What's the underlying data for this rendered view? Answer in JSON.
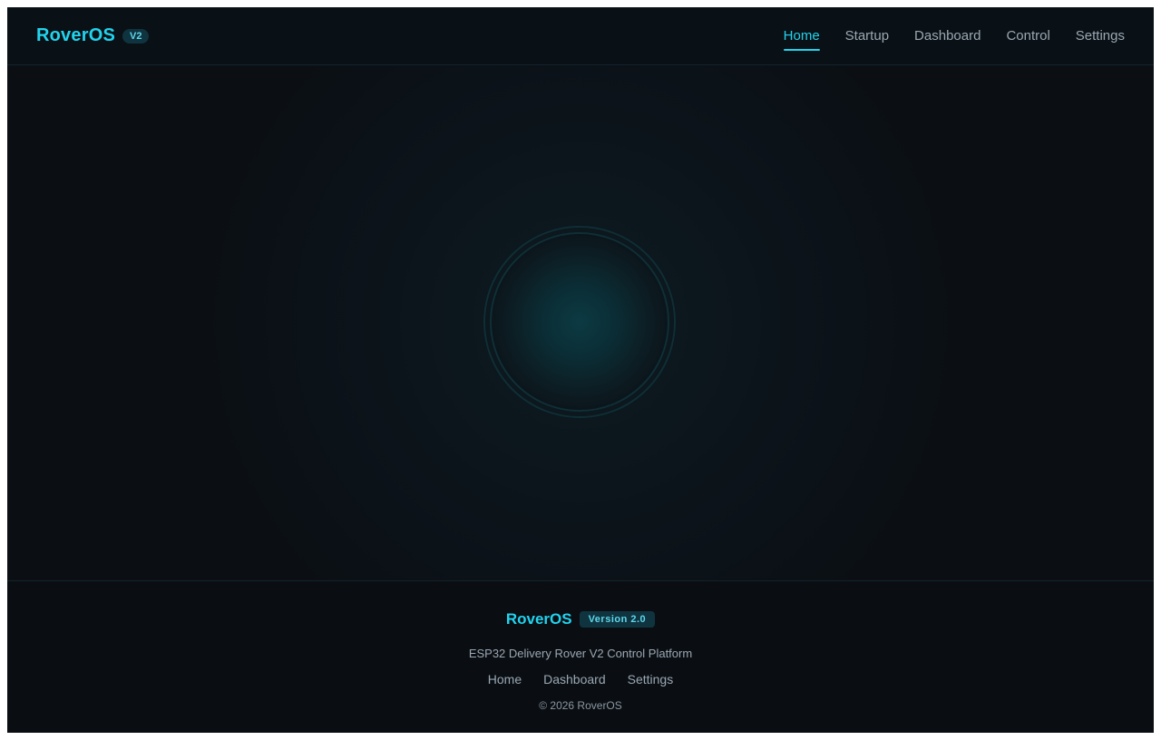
{
  "header": {
    "brand": "RoverOS",
    "badge": "V2",
    "nav": [
      {
        "label": "Home",
        "active": true
      },
      {
        "label": "Startup",
        "active": false
      },
      {
        "label": "Dashboard",
        "active": false
      },
      {
        "label": "Control",
        "active": false
      },
      {
        "label": "Settings",
        "active": false
      }
    ]
  },
  "footer": {
    "brand": "RoverOS",
    "version_badge": "Version 2.0",
    "tagline": "ESP32 Delivery Rover V2 Control Platform",
    "links": [
      "Home",
      "Dashboard",
      "Settings"
    ],
    "copyright": "© 2026 RoverOS"
  },
  "colors": {
    "accent": "#22d3ee",
    "background": "#0b0f14",
    "muted_text": "#9aa7b2"
  }
}
